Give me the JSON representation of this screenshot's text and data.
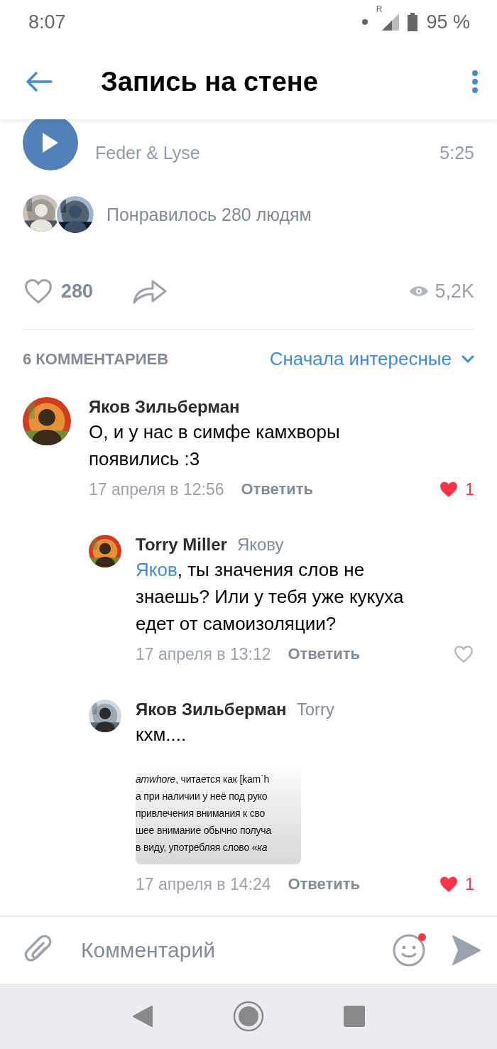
{
  "status_bar": {
    "time": "8:07",
    "network": "R",
    "battery": "95 %"
  },
  "header": {
    "title": "Запись на стене"
  },
  "audio": {
    "artist": "Feder & Lyse",
    "duration": "5:25"
  },
  "likes_summary": {
    "text": "Понравилось 280 людям"
  },
  "actions": {
    "likes": "280",
    "views": "5,2K"
  },
  "comments_header": {
    "count": "6 КОММЕНТАРИЕВ",
    "sort": "Сначала интересные"
  },
  "comments": [
    {
      "author": "Яков Зильберман",
      "text": "О, и у нас в симфе камхворы появились :3",
      "date": "17 апреля в 12:56",
      "reply": "Ответить",
      "liked": true,
      "likes": "1",
      "children": [
        {
          "author": "Torry Miller",
          "reply_to": "Якову",
          "mention": "Яков",
          "text": ", ты значения слов не знаешь? Или у тебя уже кукуха едет от самоизоляции?",
          "date": "17 апреля в 13:12",
          "reply": "Ответить",
          "liked": false
        },
        {
          "author": "Яков Зильберман",
          "reply_to": "Torry",
          "text": "кхм....",
          "attachment": {
            "lines": [
              "*amwhore*, читается как [kam`h",
              "а при наличии у неё под руко",
              "привлечения внимания к сво",
              "шее внимание обычно получа",
              "в виду, употребляя слово «*ка*"
            ]
          },
          "date": "17 апреля в 14:24",
          "reply": "Ответить",
          "liked": true,
          "likes": "1"
        }
      ]
    }
  ],
  "composer": {
    "placeholder": "Комментарий",
    "emoji_badge": true
  }
}
